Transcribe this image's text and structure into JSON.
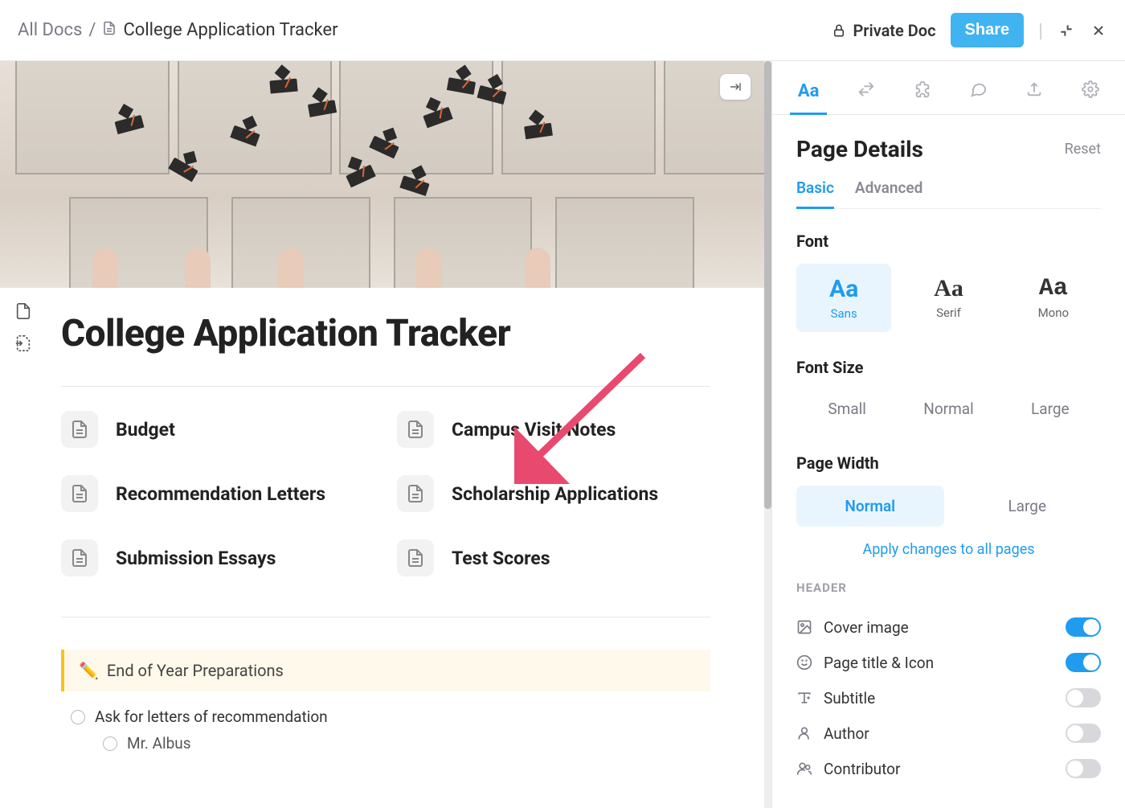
{
  "breadcrumb": {
    "root": "All Docs",
    "sep": "/",
    "title": "College Application Tracker"
  },
  "topbar": {
    "private": "Private Doc",
    "share": "Share"
  },
  "page": {
    "title": "College Application Tracker"
  },
  "subpages": [
    {
      "label": "Budget"
    },
    {
      "label": "Campus Visit Notes"
    },
    {
      "label": "Recommendation Letters"
    },
    {
      "label": "Scholarship Applications"
    },
    {
      "label": "Submission Essays"
    },
    {
      "label": "Test Scores"
    }
  ],
  "callout": {
    "emoji": "✏️",
    "text": "End of Year Preparations"
  },
  "checklist": {
    "item1": "Ask for letters of recommendation",
    "sub1": "Mr. Albus "
  },
  "panel": {
    "title": "Page Details",
    "reset": "Reset",
    "tab_basic": "Basic",
    "tab_advanced": "Advanced",
    "font_label": "Font",
    "fonts": {
      "sans": "Sans",
      "serif": "Serif",
      "mono": "Mono",
      "aa": "Aa"
    },
    "size_label": "Font Size",
    "sizes": {
      "small": "Small",
      "normal": "Normal",
      "large": "Large"
    },
    "width_label": "Page Width",
    "widths": {
      "normal": "Normal",
      "large": "Large"
    },
    "apply": "Apply changes to all pages",
    "header_label": "HEADER",
    "header_items": {
      "cover": "Cover image",
      "title_icon": "Page title & Icon",
      "subtitle": "Subtitle",
      "author": "Author",
      "contributor": "Contributor"
    }
  }
}
